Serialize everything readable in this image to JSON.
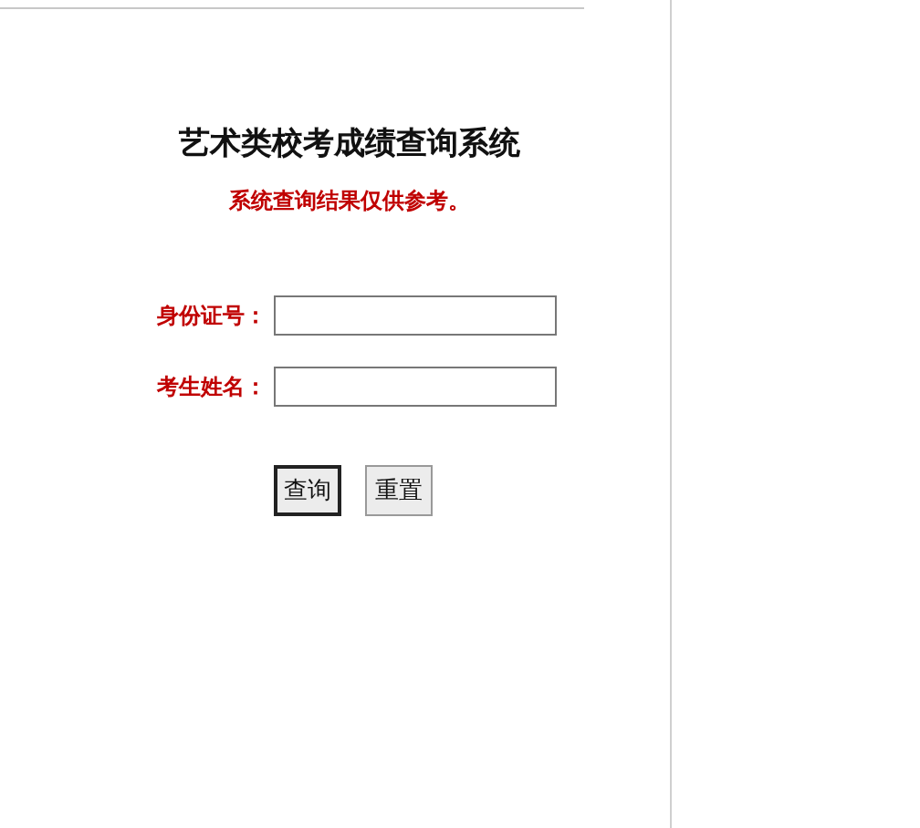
{
  "title": "艺术类校考成绩查询系统",
  "notice": "系统查询结果仅供参考。",
  "fields": [
    {
      "label": "身份证号："
    },
    {
      "label": "考生姓名："
    }
  ],
  "buttons": [
    {
      "label": "查询",
      "default": true
    },
    {
      "label": "重置",
      "default": false
    }
  ]
}
